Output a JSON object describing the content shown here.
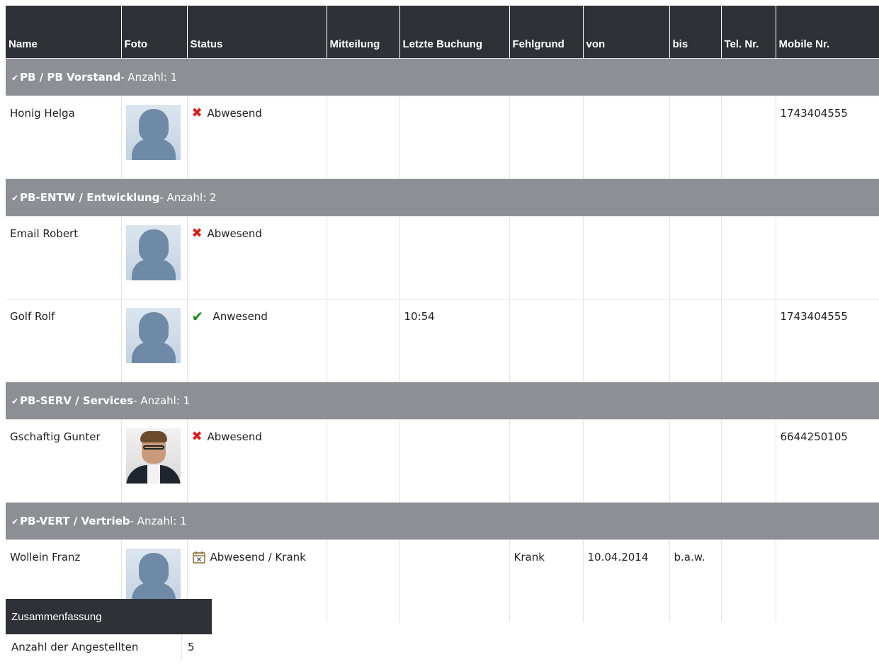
{
  "table": {
    "columns": [
      "Name",
      "Foto",
      "Status",
      "Mitteilung",
      "Letzte Buchung",
      "Fehlgrund",
      "von",
      "bis",
      "Tel. Nr.",
      "Mobile Nr."
    ],
    "groups": [
      {
        "name": "PB / PB Vorstand",
        "count_label": "- Anzahl: 1",
        "rows": [
          {
            "name": "Honig Helga",
            "status": "Abwesend",
            "status_icon": "x-icon",
            "mitteilung": "",
            "letzte_buchung": "",
            "fehlgrund": "",
            "von": "",
            "bis": "",
            "tel": "",
            "mobile": "1743404555"
          }
        ]
      },
      {
        "name": "PB-ENTW / Entwicklung",
        "count_label": "- Anzahl: 2",
        "rows": [
          {
            "name": "Email Robert",
            "status": "Abwesend",
            "status_icon": "x-icon",
            "mitteilung": "",
            "letzte_buchung": "",
            "fehlgrund": "",
            "von": "",
            "bis": "",
            "tel": "",
            "mobile": ""
          },
          {
            "name": "Golf Rolf",
            "status": "Anwesend",
            "status_icon": "check-icon",
            "mitteilung": "",
            "letzte_buchung": "10:54",
            "fehlgrund": "",
            "von": "",
            "bis": "",
            "tel": "",
            "mobile": "1743404555"
          }
        ]
      },
      {
        "name": "PB-SERV / Services",
        "count_label": "- Anzahl: 1",
        "rows": [
          {
            "name": "Gschaftig Gunter",
            "status": "Abwesend",
            "status_icon": "x-icon",
            "mitteilung": "",
            "letzte_buchung": "",
            "fehlgrund": "",
            "von": "",
            "bis": "",
            "tel": "",
            "mobile": "6644250105"
          }
        ]
      },
      {
        "name": "PB-VERT / Vertrieb",
        "count_label": "- Anzahl: 1",
        "rows": [
          {
            "name": "Wollein Franz",
            "status": "Abwesend / Krank",
            "status_icon": "calendar-x-icon",
            "mitteilung": "",
            "letzte_buchung": "",
            "fehlgrund": "Krank",
            "von": "10.04.2014",
            "bis": "b.a.w.",
            "tel": "",
            "mobile": ""
          }
        ]
      }
    ]
  },
  "summary": {
    "title": "Zusammenfassung",
    "rows": [
      {
        "label": "Anzahl der Angestellten",
        "value": "5"
      }
    ]
  },
  "colors": {
    "header_bg": "#2e3237",
    "group_bg": "#8c9095",
    "absent_icon": "#e01b1b",
    "present_icon": "#1a8a1a"
  }
}
